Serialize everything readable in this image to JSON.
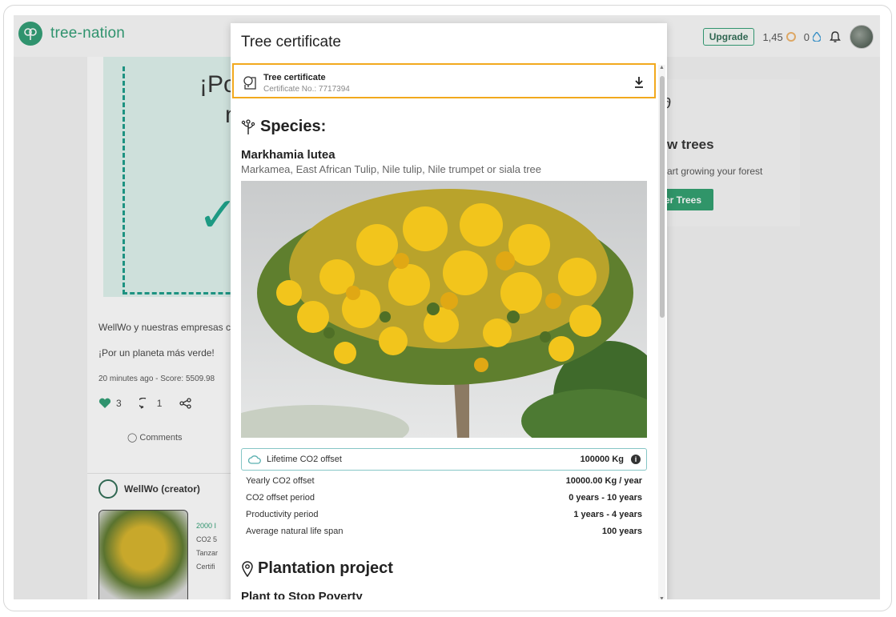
{
  "app": {
    "logo_text": "tree-nation",
    "upgrade_label": "Upgrade",
    "coins": "1,45",
    "drops": "0"
  },
  "background": {
    "big_text_1": "¡Po",
    "big_text_2": "n",
    "description": "WellWo y nuestras empresas c",
    "tagline": "¡Por un planeta más verde!",
    "meta": "20 minutes ago - Score: 5509.98",
    "likes": "3",
    "comments_count": "1",
    "comments_label": "Comments",
    "creator_name": "WellWo (creator)",
    "thumb_lines": [
      "2000 I",
      "CO2 5",
      "Tanzar",
      "Certifi"
    ],
    "right_panel": {
      "title": "w trees",
      "subtitle": "art growing your forest",
      "button_label": "er Trees"
    }
  },
  "modal": {
    "title": "Tree certificate",
    "certificate": {
      "name": "Tree certificate",
      "number": "Certificate No.: 7717394"
    },
    "species_heading": "Species:",
    "species_name": "Markhamia lutea",
    "species_common": "Markamea, East African Tulip, Nile tulip, Nile trumpet or siala tree",
    "lifetime": {
      "label": "Lifetime CO2 offset",
      "value": "100000 Kg"
    },
    "stats": [
      {
        "label": "Yearly CO2 offset",
        "value": "10000.00 Kg / year"
      },
      {
        "label": "CO2 offset period",
        "value": "0 years - 10 years"
      },
      {
        "label": "Productivity period",
        "value": "1 years - 4 years"
      },
      {
        "label": "Average natural life span",
        "value": "100 years"
      }
    ],
    "plantation_heading": "Plantation project",
    "project_name": "Plant to Stop Poverty"
  },
  "colors": {
    "brand": "#2f9e74",
    "highlight": "#f2a91d",
    "accent_border": "#86c6c6"
  }
}
